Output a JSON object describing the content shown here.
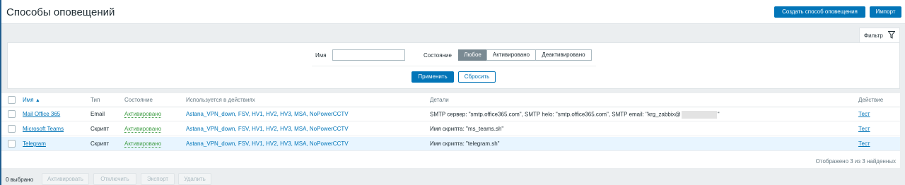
{
  "header": {
    "title": "Способы оповещений",
    "create_button": "Создать способ оповещения",
    "import_button": "Импорт"
  },
  "filter": {
    "tab_label": "Фильтр",
    "name_label": "Имя",
    "name_value": "",
    "state_label": "Состояние",
    "state_options": [
      "Любое",
      "Активировано",
      "Деактивировано"
    ],
    "state_selected": "Любое",
    "apply_button": "Применить",
    "reset_button": "Сбросить"
  },
  "table": {
    "columns": {
      "name": "Имя",
      "type": "Тип",
      "status": "Состояние",
      "used_in_actions": "Используется в действиях",
      "details": "Детали",
      "action": "Действие"
    },
    "rows": [
      {
        "name": "Mail Office 365",
        "type": "Email",
        "status": "Активировано",
        "used_in_actions": "Astana_VPN_down, FSV, HV1, HV2, HV3, MSA, NoPowerCCTV",
        "details_prefix": "SMTP сервер: \"smtp.office365.com\", SMTP helo: \"smtp.office365.com\", SMTP email: \"krg_zabbix@",
        "details_suffix": "\"",
        "action": "Тест"
      },
      {
        "name": "Microsoft Teams",
        "type": "Скрипт",
        "status": "Активировано",
        "used_in_actions": "Astana_VPN_down, FSV, HV1, HV2, HV3, MSA, NoPowerCCTV",
        "details": "Имя скрипта: \"ms_teams.sh\"",
        "action": "Тест"
      },
      {
        "name": "Telegram",
        "type": "Скрипт",
        "status": "Активировано",
        "used_in_actions": "Astana_VPN_down, FSV, HV1, HV2, HV3, MSA, NoPowerCCTV",
        "details": "Имя скрипта: \"telegram.sh\"",
        "action": "Тест"
      }
    ],
    "footer": "Отображено 3 из 3 найденных"
  },
  "bulk": {
    "selected": "0 выбрано",
    "activate": "Активировать",
    "disable": "Отключить",
    "export": "Экспорт",
    "delete": "Удалить"
  },
  "colors": {
    "primary": "#0275b8",
    "enabled": "#429e47",
    "selected_row": "#e8f5ff"
  }
}
